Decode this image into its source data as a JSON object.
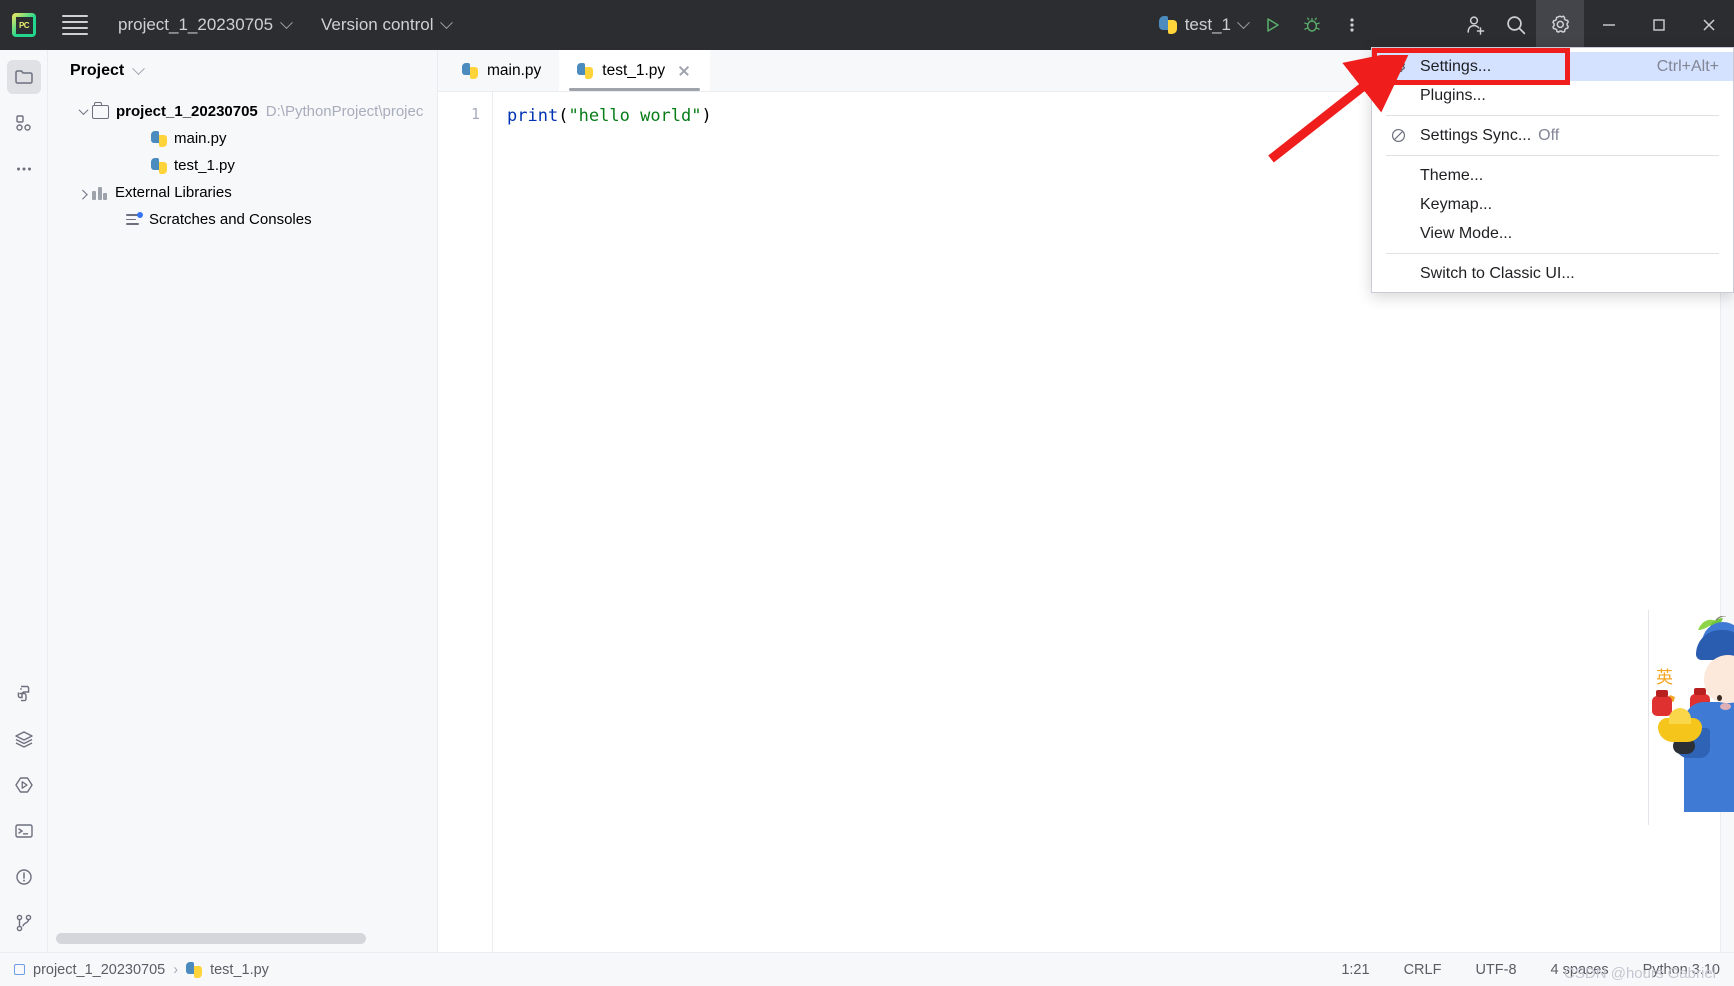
{
  "titlebar": {
    "logo_text": "PC",
    "menu_icon": "hamburger-icon",
    "project_name": "project_1_20230705",
    "version_control": "Version control",
    "run_config": "test_1",
    "run_icon": "run-icon",
    "debug_icon": "debug-icon",
    "more_icon": "more-vertical-icon",
    "account_icon": "add-user-icon",
    "search_icon": "search-icon",
    "settings_icon": "gear-icon",
    "minimize": "—",
    "maximize": "□",
    "close": "✕"
  },
  "rail": {
    "top": [
      {
        "name": "project-tool-icon",
        "selected": true
      },
      {
        "name": "commit-tool-icon",
        "selected": false
      },
      {
        "name": "more-tools-icon",
        "selected": false
      }
    ],
    "bottom": [
      {
        "name": "python-packages-icon"
      },
      {
        "name": "database-icon"
      },
      {
        "name": "run-tool-icon"
      },
      {
        "name": "terminal-icon"
      },
      {
        "name": "problems-icon"
      },
      {
        "name": "version-control-icon"
      }
    ]
  },
  "project_panel": {
    "title": "Project",
    "tree": [
      {
        "label": "project_1_20230705",
        "path": "D:\\PythonProject\\projec",
        "icon": "folder-icon",
        "expanded": true,
        "bold": true,
        "indent": 0
      },
      {
        "label": "main.py",
        "icon": "python-file-icon",
        "indent": 1
      },
      {
        "label": "test_1.py",
        "icon": "python-file-icon",
        "indent": 1
      },
      {
        "label": "External Libraries",
        "icon": "library-icon",
        "expanded": false,
        "indent": 0
      },
      {
        "label": "Scratches and Consoles",
        "icon": "scratches-icon",
        "indent": 0
      }
    ]
  },
  "editor": {
    "tabs": [
      {
        "label": "main.py",
        "icon": "python-file-icon",
        "active": false,
        "closable": false
      },
      {
        "label": "test_1.py",
        "icon": "python-file-icon",
        "active": true,
        "closable": true
      }
    ],
    "line_number": "1",
    "code": {
      "func": "print",
      "paren_open": "(",
      "string": "\"hello world\"",
      "paren_close": ")"
    }
  },
  "settings_menu": {
    "items": [
      {
        "label": "Settings...",
        "underline_index": 2,
        "shortcut": "Ctrl+Alt+",
        "icon": "gear-icon",
        "highlighted": true
      },
      {
        "label": "Plugins...",
        "icon": "",
        "highlighted": false
      },
      {
        "separator": true
      },
      {
        "label": "Settings Sync...",
        "sub": "Off",
        "icon": "no-sync-icon",
        "highlighted": false
      },
      {
        "separator": true
      },
      {
        "label": "Theme...",
        "icon": "",
        "highlighted": false
      },
      {
        "label": "Keymap...",
        "icon": "",
        "highlighted": false
      },
      {
        "label": "View Mode...",
        "icon": "",
        "highlighted": false
      },
      {
        "separator": true
      },
      {
        "label": "Switch to Classic UI...",
        "icon": "",
        "highlighted": false
      }
    ]
  },
  "statusbar": {
    "breadcrumb_project": "project_1_20230705",
    "breadcrumb_sep": "›",
    "breadcrumb_file": "test_1.py",
    "caret": "1:21",
    "line_sep": "CRLF",
    "encoding": "UTF-8",
    "indent": "4 spaces",
    "interpreter": "Python 3.10"
  },
  "ime_widget": {
    "mode_label": "英",
    "character": "sogou-mascot"
  },
  "watermark": "CSDN @hours Gabriel",
  "colors": {
    "titlebar_bg": "#2b2d30",
    "panel_bg": "#f7f8fa",
    "editor_bg": "#ffffff",
    "menu_highlight": "#d4e2ff",
    "annotation_red": "#f01d1d",
    "keyword_blue": "#0033b3",
    "string_green": "#067d17",
    "run_green": "#59a869"
  }
}
